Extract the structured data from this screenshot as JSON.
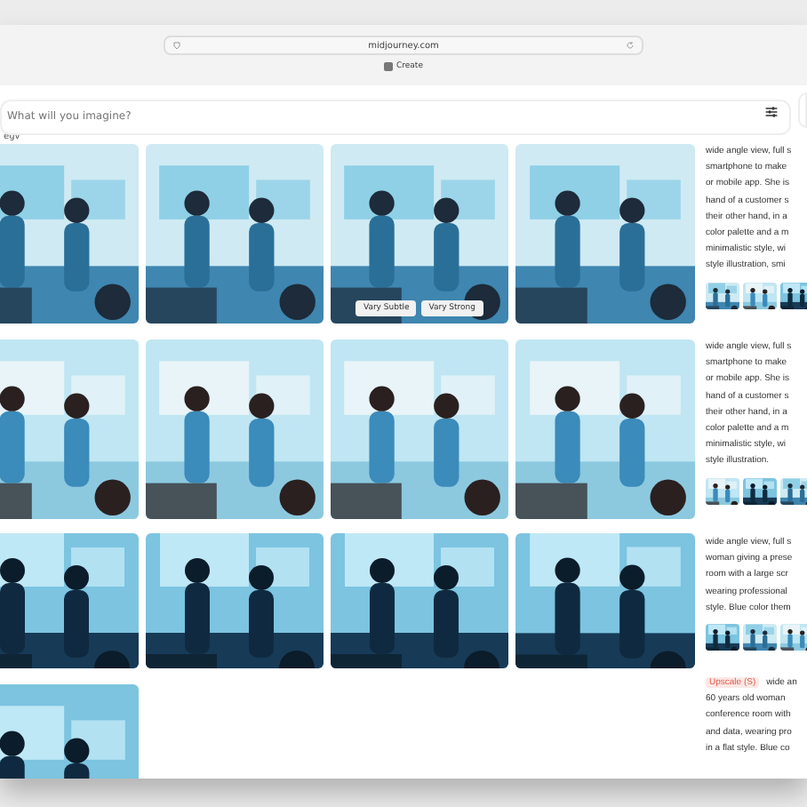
{
  "browser": {
    "address": "midjourney.com",
    "tab": "Create"
  },
  "prompt": {
    "placeholder": "What will you imagine?",
    "hint": "egv"
  },
  "images": [
    {
      "kind": "picture"
    },
    {
      "kind": "picture"
    },
    {
      "kind": "picture",
      "actions": [
        "Vary Subtle",
        "Vary Strong"
      ]
    },
    {
      "kind": "picture"
    },
    {
      "kind": "picture"
    },
    {
      "kind": "picture"
    },
    {
      "kind": "picture"
    },
    {
      "kind": "picture"
    },
    {
      "kind": "picture"
    },
    {
      "kind": "picture"
    },
    {
      "kind": "picture"
    },
    {
      "kind": "picture"
    },
    {
      "kind": "picture"
    }
  ],
  "jobs": [
    {
      "lines": [
        "wide angle view, full s",
        "smartphone to make",
        "or mobile app. She is",
        "hand of a customer s",
        "their other hand, in a",
        "color palette and a m",
        "minimalistic style, wi",
        "style illustration, smi"
      ],
      "thumbnails": [
        {
          "kind": "picture"
        },
        {
          "kind": "picture"
        },
        {
          "kind": "picture"
        }
      ]
    },
    {
      "lines": [
        "wide angle view, full s",
        "smartphone to make",
        "or mobile app. She is",
        "hand of a customer s",
        "their other hand, in a",
        "color palette and a m",
        "minimalistic style, wi",
        "style illustration."
      ],
      "thumbnails": [
        {
          "kind": "picture"
        },
        {
          "kind": "picture"
        },
        {
          "kind": "picture"
        }
      ]
    },
    {
      "lines": [
        "wide angle view, full s",
        "woman giving a prese",
        "room with a large scr",
        "wearing professional",
        "style. Blue color them"
      ],
      "thumbnails": [
        {
          "kind": "picture"
        },
        {
          "kind": "picture"
        },
        {
          "kind": "picture"
        }
      ]
    },
    {
      "badge": "Upscale (S)",
      "lines": [
        "wide an",
        "60 years old woman",
        "conference room with",
        "and data, wearing pro",
        "in a flat style. Blue co"
      ]
    }
  ]
}
